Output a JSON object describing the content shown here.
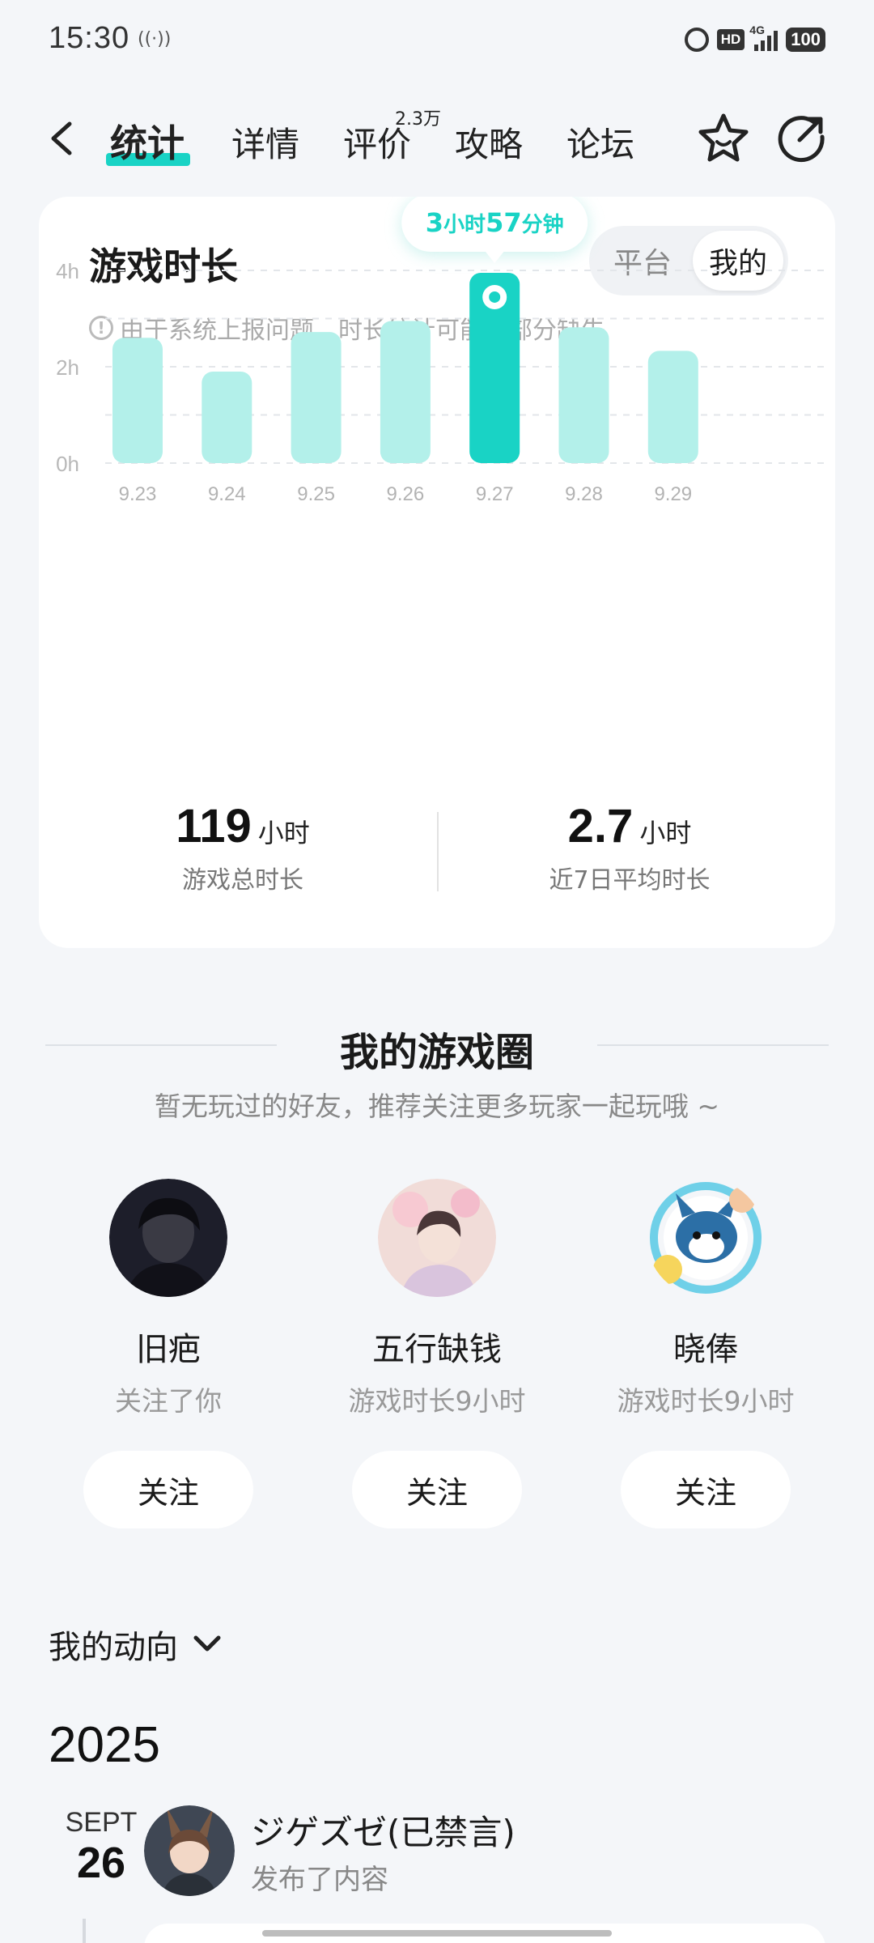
{
  "status_bar": {
    "time": "15:30",
    "net_label": "((·))",
    "hd": "HD",
    "network": "4G",
    "battery": "100"
  },
  "nav": {
    "tabs": [
      {
        "label": "统计",
        "active": true
      },
      {
        "label": "详情",
        "active": false
      },
      {
        "label": "评价",
        "active": false
      },
      {
        "label": "攻略",
        "active": false
      },
      {
        "label": "论坛",
        "active": false
      }
    ],
    "review_badge": "2.3万",
    "accent_color": "#19d3c5"
  },
  "stats_card": {
    "title": "游戏时长",
    "toggle": {
      "options": [
        "平台",
        "我的"
      ],
      "selected": "我的"
    },
    "notice": "由于系统上报问题，时长统计可能有部分缺失",
    "tooltip": {
      "prefix": "3",
      "unit1": "小时",
      "num2": "57",
      "unit2": "分钟"
    },
    "total": {
      "value": "119",
      "unit": "小时",
      "label": "游戏总时长"
    },
    "average": {
      "value": "2.7",
      "unit": "小时",
      "label": "近7日平均时长"
    }
  },
  "chart_data": {
    "type": "bar",
    "categories": [
      "9.23",
      "9.24",
      "9.25",
      "9.26",
      "9.27",
      "9.28",
      "9.29"
    ],
    "values": [
      2.6,
      1.9,
      2.72,
      2.95,
      3.95,
      2.82,
      2.33
    ],
    "highlight_index": 4,
    "y_ticks": [
      "0h",
      "2h",
      "4h"
    ],
    "ylim": [
      0,
      4
    ],
    "bar_color": "#b3f0ea",
    "highlight_color": "#19d3c5",
    "grid": true
  },
  "game_circle": {
    "title": "我的游戏圈",
    "subtitle": "暂无玩过的好友，推荐关注更多玩家一起玩哦 ~",
    "friends": [
      {
        "name": "旧疤",
        "desc": "关注了你",
        "button": "关注"
      },
      {
        "name": "五行缺钱",
        "desc": "游戏时长9小时",
        "button": "关注"
      },
      {
        "name": "晓俸",
        "desc": "游戏时长9小时",
        "button": "关注"
      }
    ]
  },
  "activity": {
    "title": "我的动向",
    "year": "2025",
    "month": "SEPT",
    "day": "26",
    "user": "ジゲズゼ(已禁言)",
    "action": "发布了内容"
  }
}
